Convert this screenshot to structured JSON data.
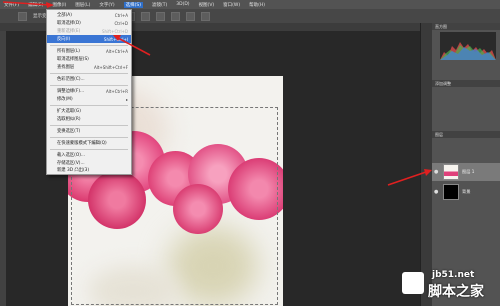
{
  "menubar": {
    "items": [
      "文件(F)",
      "编辑(E)",
      "图像(I)",
      "图层(L)",
      "文字(Y)",
      "选择(S)",
      "滤镜(T)",
      "3D(D)",
      "视图(V)",
      "窗口(W)",
      "帮助(H)"
    ],
    "active_index": 5
  },
  "options": {
    "label": "显示变换控件"
  },
  "select_menu": {
    "items": [
      {
        "label": "全部(A)",
        "shortcut": "Ctrl+A",
        "state": "normal"
      },
      {
        "label": "取消选择(D)",
        "shortcut": "Ctrl+D",
        "state": "normal"
      },
      {
        "label": "重新选择(E)",
        "shortcut": "Shift+Ctrl+D",
        "state": "disabled"
      },
      {
        "label": "反向(I)",
        "shortcut": "Shift+Ctrl+I",
        "state": "highlighted"
      },
      {
        "label": "所有图层(L)",
        "shortcut": "Alt+Ctrl+A",
        "state": "normal"
      },
      {
        "label": "取消选择图层(S)",
        "shortcut": "",
        "state": "normal"
      },
      {
        "label": "查找图层",
        "shortcut": "Alt+Shift+Ctrl+F",
        "state": "normal"
      },
      {
        "label": "色彩范围(C)...",
        "shortcut": "",
        "state": "normal"
      },
      {
        "label": "调整边缘(F)...",
        "shortcut": "Alt+Ctrl+R",
        "state": "normal"
      },
      {
        "label": "修改(M)",
        "shortcut": "▸",
        "state": "normal"
      },
      {
        "label": "扩大选取(G)",
        "shortcut": "",
        "state": "normal"
      },
      {
        "label": "选取相似(R)",
        "shortcut": "",
        "state": "normal"
      },
      {
        "label": "变换选区(T)",
        "shortcut": "",
        "state": "normal"
      },
      {
        "label": "在快速蒙版模式下编辑(Q)",
        "shortcut": "",
        "state": "normal"
      },
      {
        "label": "载入选区(O)...",
        "shortcut": "",
        "state": "normal"
      },
      {
        "label": "存储选区(V)...",
        "shortcut": "",
        "state": "normal"
      },
      {
        "label": "新建 3D 凸出(3)",
        "shortcut": "",
        "state": "normal"
      }
    ]
  },
  "panels": {
    "histogram_tab": "直方图",
    "adjust_tab": "添加调整",
    "layers_tab": "图层",
    "layers": [
      {
        "name": "图层 1",
        "selected": true
      },
      {
        "name": "背景",
        "selected": false
      }
    ]
  },
  "watermark": {
    "url": "jb51.net",
    "text": "脚本之家"
  },
  "colors": {
    "menu_highlight": "#3a75d4",
    "arrow": "#e02020",
    "flower": "#e8437a"
  }
}
